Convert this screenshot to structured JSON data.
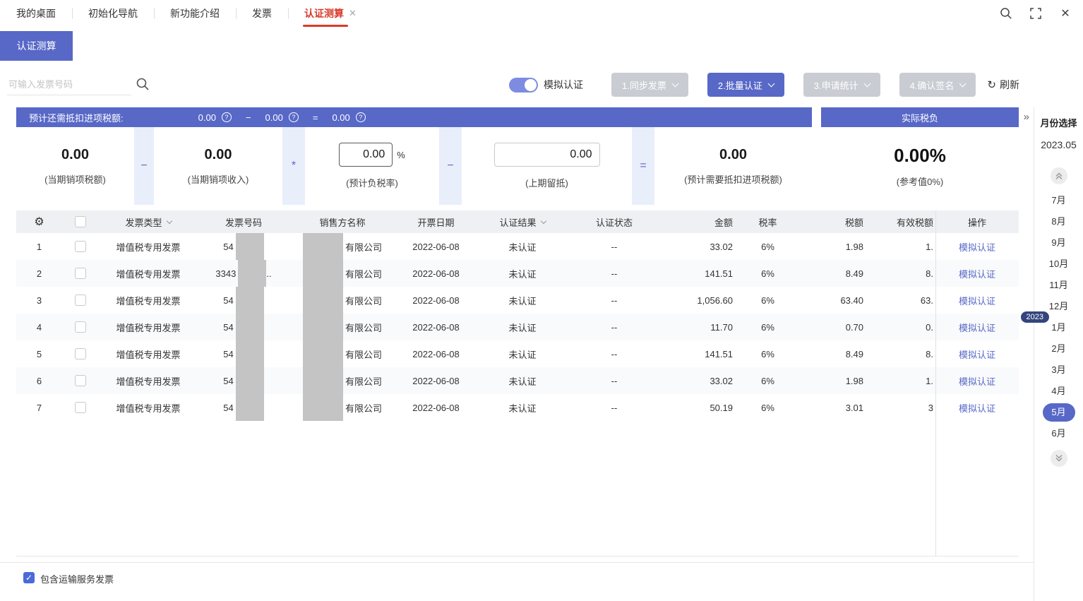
{
  "colors": {
    "primary": "#5868c7",
    "accent_red": "#d83b2b",
    "link": "#5868c7",
    "disabled_button": "#c9ccd2",
    "year_badge_bg": "#33457c",
    "redaction_gray": "#c4c4c4"
  },
  "icons": {
    "info": "?",
    "gear": "⚙",
    "refresh": "↻",
    "collapse": "»",
    "close": "✕",
    "check": "✓"
  },
  "topbar": {
    "tabs": [
      {
        "label": "我的桌面",
        "active": false,
        "closable": false
      },
      {
        "label": "初始化导航",
        "active": false,
        "closable": false
      },
      {
        "label": "新功能介绍",
        "active": false,
        "closable": false
      },
      {
        "label": "发票",
        "active": false,
        "closable": false
      },
      {
        "label": "认证测算",
        "active": true,
        "closable": true
      }
    ]
  },
  "subtab": {
    "label": "认证测算"
  },
  "toolbar": {
    "search": {
      "placeholder": "可输入发票号码",
      "value": ""
    },
    "toggle": {
      "label": "模拟认证",
      "on": true
    },
    "buttons": [
      {
        "label": "1.同步发票",
        "variant": "disabled"
      },
      {
        "label": "2.批量认证",
        "variant": "primary"
      },
      {
        "label": "3.申请统计",
        "variant": "disabled"
      },
      {
        "label": "4.确认签名",
        "variant": "disabled"
      }
    ],
    "refresh_label": "刷新"
  },
  "summary": {
    "banner": {
      "label": "预计还需抵扣进项税额:",
      "v1": "0.00",
      "op1": "−",
      "v2": "0.00",
      "op2": "=",
      "v3": "0.00"
    },
    "formula": {
      "v1": "0.00",
      "l1": "(当期销项税额)",
      "op1": "−",
      "v2": "0.00",
      "l2": "(当期销项收入)",
      "op2": "*",
      "v3": "0.00",
      "v3_suffix": "%",
      "l3": "(预计负税率)",
      "op3": "−",
      "v4": "0.00",
      "l4": "(上期留抵)",
      "op4": "=",
      "v5": "0.00",
      "l5": "(预计需要抵扣进项税额)"
    },
    "actual": {
      "title": "实际税负",
      "value": "0.00%",
      "note": "(参考值0%)"
    }
  },
  "table": {
    "columns": [
      {
        "key": "type",
        "label": "发票类型",
        "filter": true
      },
      {
        "key": "num",
        "label": "发票号码",
        "filter": false
      },
      {
        "key": "seller",
        "label": "销售方名称",
        "filter": false
      },
      {
        "key": "date",
        "label": "开票日期",
        "filter": false
      },
      {
        "key": "result",
        "label": "认证结果",
        "filter": true
      },
      {
        "key": "status",
        "label": "认证状态",
        "filter": false
      },
      {
        "key": "amount",
        "label": "金额",
        "filter": false
      },
      {
        "key": "rate",
        "label": "税率",
        "filter": false
      },
      {
        "key": "tax",
        "label": "税额",
        "filter": false
      },
      {
        "key": "valid",
        "label": "有效税额",
        "filter": false
      },
      {
        "key": "action",
        "label": "操作",
        "filter": false
      }
    ],
    "rows": [
      {
        "idx": "1",
        "type": "增值税专用发票",
        "num_pre": "54",
        "num_post": "",
        "seller": "有限公司",
        "date": "2022-06-08",
        "result": "未认证",
        "status": "--",
        "amount": "33.02",
        "rate": "6%",
        "tax": "1.98",
        "valid": "1.",
        "action": "模拟认证"
      },
      {
        "idx": "2",
        "type": "增值税专用发票",
        "num_pre": "3343",
        "num_post": "..",
        "seller": "有限公司",
        "date": "2022-06-08",
        "result": "未认证",
        "status": "--",
        "amount": "141.51",
        "rate": "6%",
        "tax": "8.49",
        "valid": "8.",
        "action": "模拟认证"
      },
      {
        "idx": "3",
        "type": "增值税专用发票",
        "num_pre": "54",
        "num_post": "",
        "seller": "有限公司",
        "date": "2022-06-08",
        "result": "未认证",
        "status": "--",
        "amount": "1,056.60",
        "rate": "6%",
        "tax": "63.40",
        "valid": "63.",
        "action": "模拟认证"
      },
      {
        "idx": "4",
        "type": "增值税专用发票",
        "num_pre": "54",
        "num_post": "",
        "seller": "有限公司",
        "date": "2022-06-08",
        "result": "未认证",
        "status": "--",
        "amount": "11.70",
        "rate": "6%",
        "tax": "0.70",
        "valid": "0.",
        "action": "模拟认证"
      },
      {
        "idx": "5",
        "type": "增值税专用发票",
        "num_pre": "54",
        "num_post": "",
        "seller": "有限公司",
        "date": "2022-06-08",
        "result": "未认证",
        "status": "--",
        "amount": "141.51",
        "rate": "6%",
        "tax": "8.49",
        "valid": "8.",
        "action": "模拟认证"
      },
      {
        "idx": "6",
        "type": "增值税专用发票",
        "num_pre": "54",
        "num_post": "",
        "seller": "有限公司",
        "date": "2022-06-08",
        "result": "未认证",
        "status": "--",
        "amount": "33.02",
        "rate": "6%",
        "tax": "1.98",
        "valid": "1.",
        "action": "模拟认证"
      },
      {
        "idx": "7",
        "type": "增值税专用发票",
        "num_pre": "54",
        "num_post": "",
        "seller": "有限公司",
        "date": "2022-06-08",
        "result": "未认证",
        "status": "--",
        "amount": "50.19",
        "rate": "6%",
        "tax": "3.01",
        "valid": "3",
        "action": "模拟认证"
      }
    ]
  },
  "month_panel": {
    "title": "月份选择",
    "current": "2023.05",
    "year_badge": "2023",
    "months": [
      "7月",
      "8月",
      "9月",
      "10月",
      "11月",
      "12月",
      "1月",
      "2月",
      "3月",
      "4月",
      "5月",
      "6月"
    ],
    "selected": "5月"
  },
  "footer": {
    "checkbox_label": "包含运输服务发票",
    "checked": true
  }
}
